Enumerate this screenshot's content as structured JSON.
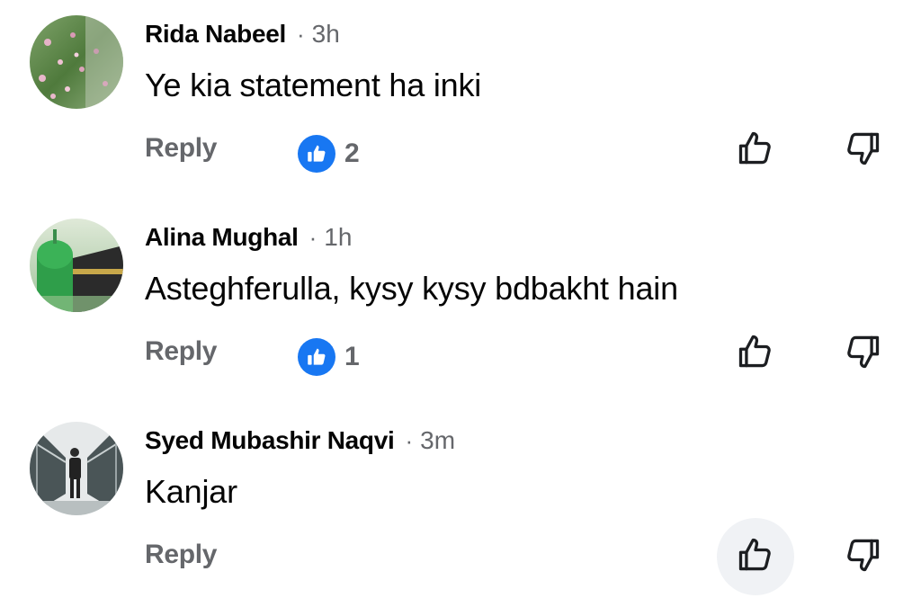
{
  "comments": [
    {
      "author": "Rida Nabeel",
      "separator": "·",
      "time": "3h",
      "text": "Ye kia statement ha inki",
      "reply_label": "Reply",
      "like_count": "2",
      "avatar_theme": "flowers"
    },
    {
      "author": "Alina Mughal",
      "separator": "·",
      "time": "1h",
      "text": "Asteghferulla, kysy kysy bdbakht hain",
      "reply_label": "Reply",
      "like_count": "1",
      "avatar_theme": "green-dome"
    },
    {
      "author": "Syed Mubashir Naqvi",
      "separator": "·",
      "time": "3m",
      "text": "Kanjar",
      "reply_label": "Reply",
      "like_count": "",
      "avatar_theme": "person-in-corridor"
    }
  ],
  "icons": {
    "reaction_badge": "like-reaction-icon",
    "upvote": "thumbs-up-outline-icon",
    "downvote": "thumbs-down-outline-icon"
  },
  "colors": {
    "accent": "#1877f2",
    "secondary_text": "#65676b",
    "primary_text": "#050505",
    "pressed_background": "#f0f2f5"
  }
}
